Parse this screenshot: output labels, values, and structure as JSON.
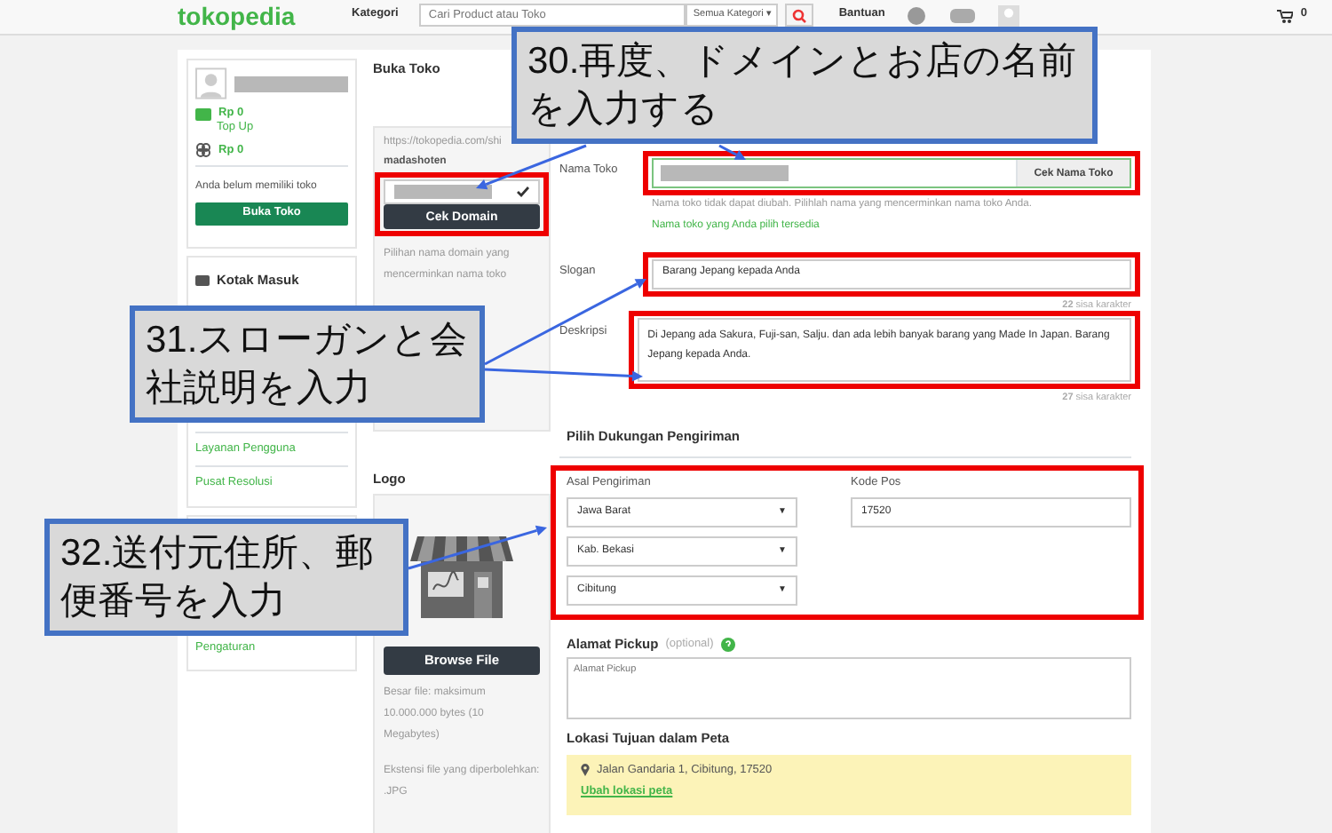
{
  "header": {
    "logo": "tokopedia",
    "menu": "Kategori",
    "search": {
      "placeholder": "Cari Product atau Toko"
    },
    "category": "Semua Kategori ▾",
    "help": "Bantuan",
    "cart_count": "0"
  },
  "sidebar": {
    "balance": "Rp 0",
    "top_up": "Top Up",
    "points": "Rp 0",
    "no_shop": "Anda belum memiliki toko",
    "open_shop": "Buka Toko",
    "inbox_title": "Kotak Masuk",
    "inbox_items": [
      "Layanan Pengguna",
      "Pusat Resolusi"
    ],
    "profile_items": [
      "Pengaturan"
    ]
  },
  "page_title": "Buka Toko",
  "domain_panel": {
    "url": "https://tokopedia.com/shi",
    "domain": "madashoten",
    "valid": true,
    "button": "Cek Domain",
    "help_lines": [
      "Pilihan nama domain yang",
      "mencerminkan nama toko"
    ]
  },
  "logo_panel": {
    "title": "Logo",
    "button": "Browse File",
    "size_note": "Besar file: maksimum 10.000.000 bytes (10 Megabytes)",
    "ext_note": "Ekstensi file yang diperbolehkan: .JPG"
  },
  "form": {
    "shop_name": {
      "label": "Nama Toko",
      "button": "Cek Nama Toko",
      "help": "Nama toko tidak dapat diubah. Pilihlah nama yang mencerminkan nama toko Anda.",
      "status": "Nama toko yang Anda pilih tersedia"
    },
    "slogan": {
      "label": "Slogan",
      "value": "Barang Jepang kepada Anda",
      "remaining": "22",
      "remaining_label": "sisa karakter"
    },
    "description": {
      "label": "Deskripsi",
      "value": "Di Jepang ada Sakura, Fuji-san, Salju. dan ada lebih banyak barang yang Made In Japan. Barang Jepang kepada Anda.",
      "remaining": "27",
      "remaining_label": "sisa karakter"
    },
    "shipping_title": "Pilih Dukungan Pengiriman",
    "origin_label": "Asal Pengiriman",
    "origin_selects": [
      {
        "value": "Jawa Barat",
        "arrow": "▼"
      },
      {
        "value": "Kab. Bekasi",
        "arrow": "▼"
      },
      {
        "value": "Cibitung",
        "arrow": "▼"
      }
    ],
    "postal_label": "Kode Pos",
    "postal_value": "17520",
    "pickup_label": "Alamat Pickup",
    "pickup_optional": "(optional)",
    "pickup_placeholder": "Alamat Pickup",
    "map_title": "Lokasi Tujuan dalam Peta",
    "map_address": "Jalan Gandaria 1, Cibitung, 17520",
    "map_link": "Ubah lokasi peta"
  },
  "annotations": [
    {
      "text": "30.再度、ドメインとお店の名前を入力する"
    },
    {
      "text": "31.スローガンと会社説明を入力"
    },
    {
      "text": "32.送付元住所、郵便番号を入力"
    }
  ]
}
